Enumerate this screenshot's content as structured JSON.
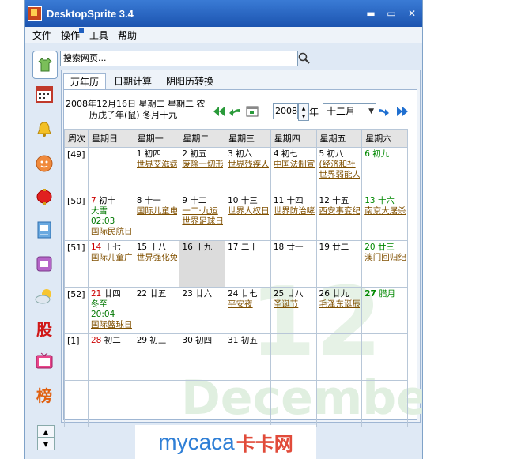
{
  "app": {
    "title": "DesktopSprite 3.4"
  },
  "window_buttons": {
    "minimize": "▬",
    "maximize": "▭",
    "close": "✕"
  },
  "menu": [
    "文件",
    "操作",
    "工具",
    "帮助"
  ],
  "sidebar": {
    "icons": [
      "shirt-icon",
      "calendar-icon",
      "bell-icon",
      "face-icon",
      "lantern-icon",
      "phone-book-icon",
      "telephone-icon",
      "weather-icon",
      "stock-icon",
      "tv-icon",
      "ranking-icon"
    ],
    "stock_text": "股",
    "ranking_text": "榜",
    "tv_text": "TV",
    "scroll_up": "▲",
    "scroll_down": "▼"
  },
  "search": {
    "value": "搜索网页..."
  },
  "tabs": [
    "万年历",
    "日期计算",
    "阴阳历转换"
  ],
  "calendar": {
    "date_text_line1": "2008年12月16日 星期二 星期二 农",
    "date_text_line2": "历戊子年(鼠) 冬月十九",
    "year": "2008",
    "year_label": "年",
    "month": "十二月",
    "headers": [
      "周次",
      "星期日",
      "星期一",
      "星期二",
      "星期三",
      "星期四",
      "星期五",
      "星期六"
    ],
    "weeks": [
      {
        "week": "[49]",
        "days": [
          {
            "d": "",
            "l": ""
          },
          {
            "d": "1",
            "l": "初四",
            "f": "世界艾滋病"
          },
          {
            "d": "2",
            "l": "初五",
            "f": "废除一切形"
          },
          {
            "d": "3",
            "l": "初六",
            "f": "世界残疾人"
          },
          {
            "d": "4",
            "l": "初七",
            "f": "中国法制宣"
          },
          {
            "d": "5",
            "l": "初八",
            "f": "(经济和社",
            "f2": "世界弱能人"
          },
          {
            "d": "6",
            "l": "初九"
          }
        ]
      },
      {
        "week": "[50]",
        "days": [
          {
            "d": "7",
            "l": "初十",
            "t": "大雪",
            "t2": "02:03",
            "f": "国际民航日"
          },
          {
            "d": "8",
            "l": "十一",
            "f": "国际儿童电"
          },
          {
            "d": "9",
            "l": "十二",
            "f": "一二·九运",
            "f2": "世界足球日"
          },
          {
            "d": "10",
            "l": "十三",
            "f": "世界人权日"
          },
          {
            "d": "11",
            "l": "十四",
            "f": "世界防治哮"
          },
          {
            "d": "12",
            "l": "十五",
            "f": "西安事变纪"
          },
          {
            "d": "13",
            "l": "十六",
            "f": "南京大屠杀"
          }
        ]
      },
      {
        "week": "[51]",
        "days": [
          {
            "d": "14",
            "l": "十七",
            "f": "国际儿童广"
          },
          {
            "d": "15",
            "l": "十八",
            "f": "世界强化免"
          },
          {
            "d": "16",
            "l": "十九",
            "today": true
          },
          {
            "d": "17",
            "l": "二十"
          },
          {
            "d": "18",
            "l": "廿一"
          },
          {
            "d": "19",
            "l": "廿二"
          },
          {
            "d": "20",
            "l": "廿三",
            "f": "澳门回归纪"
          }
        ]
      },
      {
        "week": "[52]",
        "days": [
          {
            "d": "21",
            "l": "廿四",
            "t": "冬至",
            "t2": "20:04",
            "f": "国际篮球日"
          },
          {
            "d": "22",
            "l": "廿五"
          },
          {
            "d": "23",
            "l": "廿六"
          },
          {
            "d": "24",
            "l": "廿七",
            "f": "平安夜"
          },
          {
            "d": "25",
            "l": "廿八",
            "f": "圣诞节"
          },
          {
            "d": "26",
            "l": "廿九",
            "f": "毛泽东诞辰"
          },
          {
            "d": "27",
            "l": "腊月",
            "bold": true
          }
        ]
      },
      {
        "week": "[1]",
        "days": [
          {
            "d": "28",
            "l": "初二"
          },
          {
            "d": "29",
            "l": "初三"
          },
          {
            "d": "30",
            "l": "初四"
          },
          {
            "d": "31",
            "l": "初五"
          },
          {
            "d": "",
            "l": ""
          },
          {
            "d": "",
            "l": ""
          },
          {
            "d": "",
            "l": ""
          }
        ]
      },
      {
        "week": "",
        "days": [
          {
            "d": "",
            "l": ""
          },
          {
            "d": "",
            "l": ""
          },
          {
            "d": "",
            "l": ""
          },
          {
            "d": "",
            "l": ""
          },
          {
            "d": "",
            "l": ""
          },
          {
            "d": "",
            "l": ""
          },
          {
            "d": "",
            "l": ""
          }
        ]
      }
    ],
    "watermark_num": "12",
    "watermark_word": "December"
  },
  "logo": {
    "part1": "mycaca",
    "part2": "卡卡网"
  },
  "colors": {
    "titlebar": "#1c54b0",
    "sunday": "#cc0000",
    "saturday": "#008800",
    "festival": "#805000"
  }
}
